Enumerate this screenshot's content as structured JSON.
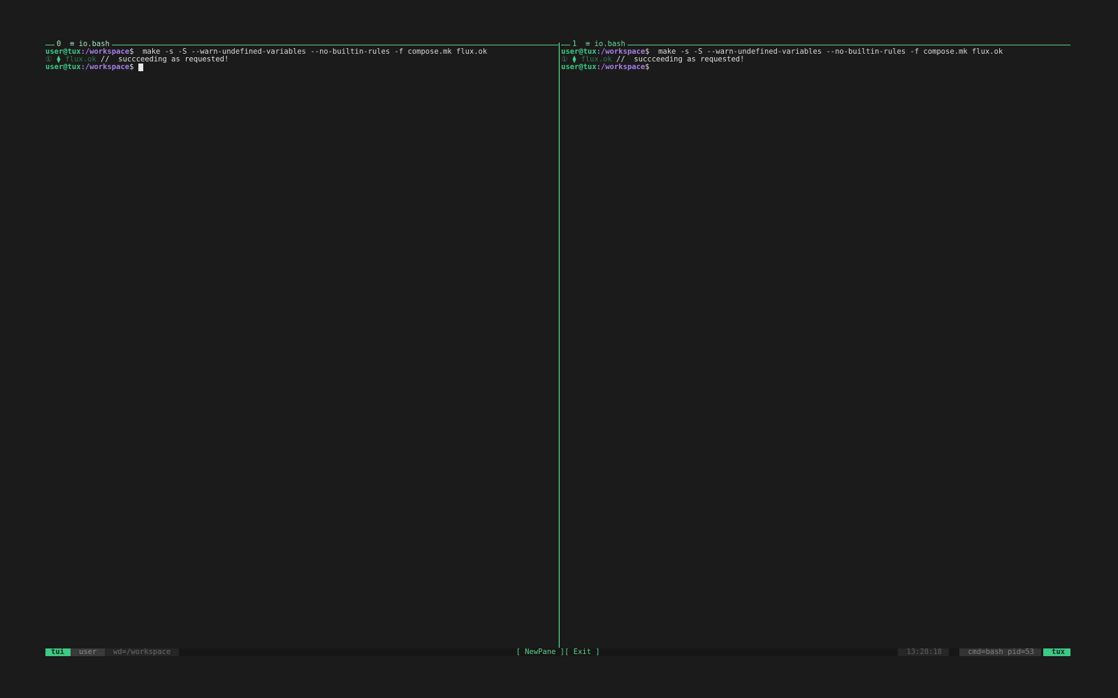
{
  "panes": [
    {
      "title": "0  ≡ io.bash",
      "prompt_user": "user@tux",
      "prompt_path": ":/workspace",
      "prompt_end": "$",
      "command": "  make -s -S --warn-undefined-variables --no-builtin-rules -f compose.mk flux.ok",
      "out_num": "①",
      "out_icon": "⧫",
      "out_target": "flux.ok",
      "out_sep": " // ",
      "out_msg": " succceeding as requested!"
    },
    {
      "title": "1  ≡ io.bash",
      "prompt_user": "user@tux",
      "prompt_path": ":/workspace",
      "prompt_end": "$",
      "command": "  make -s -S --warn-undefined-variables --no-builtin-rules -f compose.mk flux.ok",
      "out_num": "①",
      "out_icon": "⧫",
      "out_target": "flux.ok",
      "out_sep": " // ",
      "out_msg": " succceeding as requested!"
    }
  ],
  "statusbar": {
    "session": "tui",
    "user": "user",
    "wd": "wd=/workspace",
    "new_pane": "[ NewPane ]",
    "exit": "[ Exit ]",
    "time": "13:28:18",
    "cmd": "cmd=bash pid=53",
    "host": "tux"
  },
  "colors": {
    "accent": "#3ec985",
    "path": "#a77ee6",
    "background": "#1b1b1b"
  }
}
